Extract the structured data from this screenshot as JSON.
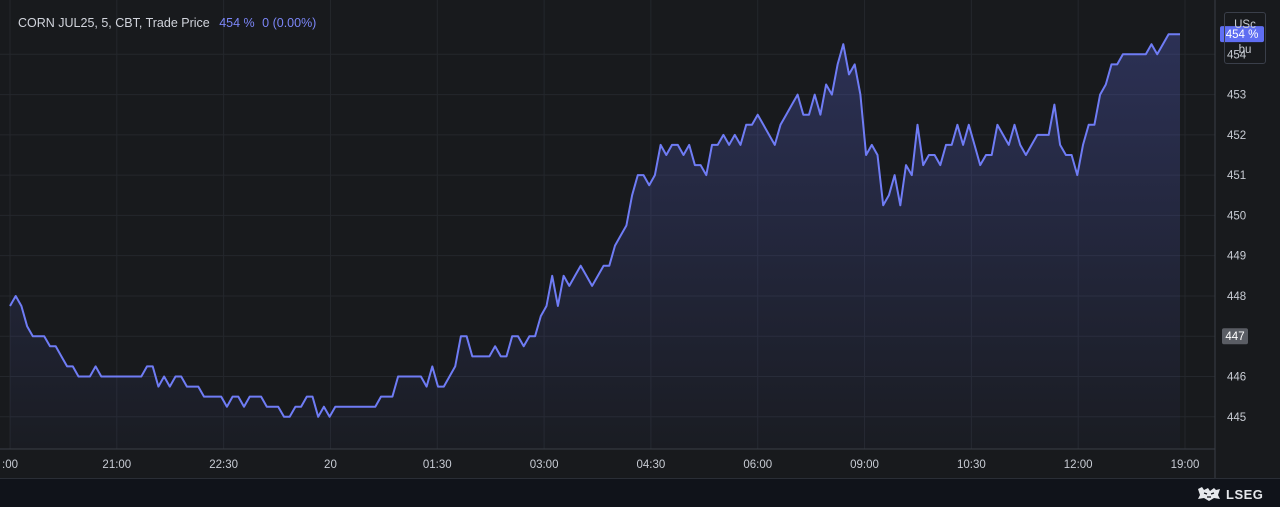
{
  "legend": {
    "symbol": "CORN JUL25, 5, CBT, Trade Price",
    "last_value": "454 %",
    "change": "0 (0.00%)"
  },
  "unit": {
    "line1": "USc",
    "line2": "bu"
  },
  "price_badge": "454 %",
  "crosshair_badge": "447",
  "footer": {
    "brand": "LSEG"
  },
  "colors": {
    "line": "#6f7cf5",
    "background": "#181a1d",
    "badge": "#5f6ef2",
    "crosshair_badge": "#5a5d64"
  },
  "chart_data": {
    "type": "area",
    "ylim": [
      444.2,
      455.1
    ],
    "y_ticks": [
      445,
      446,
      447,
      448,
      449,
      450,
      451,
      452,
      453,
      454
    ],
    "x_tick_labels": [
      ":00",
      "21:00",
      "22:30",
      "20",
      "01:30",
      "03:00",
      "04:30",
      "06:00",
      "09:00",
      "10:30",
      "12:00",
      "19:00"
    ],
    "grid": true,
    "series": [
      {
        "values": [
          447.75,
          448,
          447.75,
          447.25,
          447,
          447,
          447,
          446.75,
          446.75,
          446.5,
          446.25,
          446.25,
          446,
          446,
          446,
          446.25,
          446,
          446,
          446,
          446,
          446,
          446,
          446,
          446,
          446.25,
          446.25,
          445.75,
          446,
          445.75,
          446,
          446,
          445.75,
          445.75,
          445.75,
          445.5,
          445.5,
          445.5,
          445.5,
          445.25,
          445.5,
          445.5,
          445.25,
          445.5,
          445.5,
          445.5,
          445.25,
          445.25,
          445.25,
          445,
          445,
          445.25,
          445.25,
          445.5,
          445.5,
          445,
          445.25,
          445,
          445.25,
          445.25,
          445.25,
          445.25,
          445.25,
          445.25,
          445.25,
          445.25,
          445.5,
          445.5,
          445.5,
          446,
          446,
          446,
          446,
          446,
          445.75,
          446.25,
          445.75,
          445.75,
          446,
          446.25,
          447,
          447,
          446.5,
          446.5,
          446.5,
          446.5,
          446.75,
          446.5,
          446.5,
          447,
          447,
          446.75,
          447,
          447,
          447.5,
          447.75,
          448.5,
          447.75,
          448.5,
          448.25,
          448.5,
          448.75,
          448.5,
          448.25,
          448.5,
          448.75,
          448.75,
          449.25,
          449.5,
          449.75,
          450.5,
          451,
          451,
          450.75,
          451,
          451.75,
          451.5,
          451.75,
          451.75,
          451.5,
          451.75,
          451.25,
          451.25,
          451,
          451.75,
          451.75,
          452,
          451.75,
          452,
          451.75,
          452.25,
          452.25,
          452.5,
          452.25,
          452,
          451.75,
          452.25,
          452.5,
          452.75,
          453,
          452.5,
          452.5,
          453,
          452.5,
          453.25,
          453,
          453.75,
          454.25,
          453.5,
          453.75,
          453,
          451.5,
          451.75,
          451.5,
          450.25,
          450.5,
          451,
          450.25,
          451.25,
          451,
          452.25,
          451.25,
          451.5,
          451.5,
          451.25,
          451.75,
          451.75,
          452.25,
          451.75,
          452.25,
          451.75,
          451.25,
          451.5,
          451.5,
          452.25,
          452,
          451.75,
          452.25,
          451.75,
          451.5,
          451.75,
          452,
          452,
          452,
          452.75,
          451.75,
          451.5,
          451.5,
          451,
          451.75,
          452.25,
          452.25,
          453,
          453.25,
          453.75,
          453.75,
          454,
          454,
          454,
          454,
          454,
          454.25,
          454,
          454.25,
          454.5,
          454.5,
          454.5
        ]
      }
    ]
  }
}
